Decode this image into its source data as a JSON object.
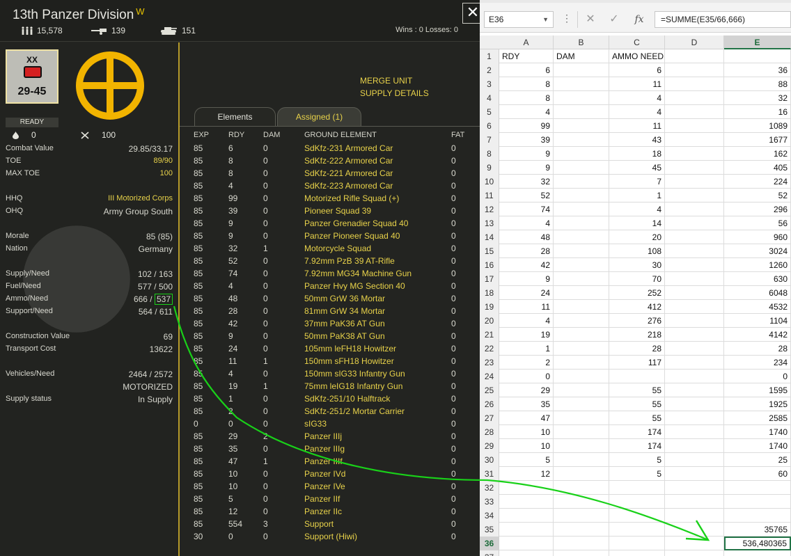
{
  "unit": {
    "title": "13th Panzer Division",
    "title_suffix": "W",
    "men": "15,578",
    "guns": "139",
    "tanks": "151",
    "wins_losses": "Wins : 0  Losses: 0",
    "counter_size": "XX",
    "counter_strength": "29-45",
    "status": "READY",
    "mini_left": "0",
    "mini_right": "100"
  },
  "stats": [
    {
      "label": "Combat Value",
      "value": "29.85/33.17",
      "style": "wh"
    },
    {
      "label": "TOE",
      "value": "89/90",
      "style": "yel"
    },
    {
      "label": "MAX TOE",
      "value": "100",
      "style": "yel"
    },
    {
      "label": "HHQ",
      "value": "III Motorized Corps",
      "style": "yel"
    },
    {
      "label": "OHQ",
      "value": "Army Group South",
      "style": "wh"
    },
    {
      "label": "Morale",
      "value": "85 (85)",
      "style": "wh"
    },
    {
      "label": "Nation",
      "value": "Germany",
      "style": "wh"
    },
    {
      "label": "Supply/Need",
      "value": "102 / 163",
      "style": "wh"
    },
    {
      "label": "Fuel/Need",
      "value": "577 / 500",
      "style": "wh"
    },
    {
      "label": "Ammo/Need",
      "value": "666 / ",
      "style": "wh",
      "highlight": "537"
    },
    {
      "label": "Support/Need",
      "value": "564 / 611",
      "style": "wh"
    },
    {
      "label": "Construction Value",
      "value": "69",
      "style": "wh"
    },
    {
      "label": "Transport Cost",
      "value": "13622",
      "style": "wh"
    },
    {
      "label": "Vehicles/Need",
      "value": "2464 / 2572",
      "style": "wh"
    },
    {
      "label": "",
      "value": "MOTORIZED",
      "style": "wh"
    },
    {
      "label": "Supply status",
      "value": "In Supply",
      "style": "wh"
    }
  ],
  "links": {
    "merge": "MERGE UNIT",
    "supply": "SUPPLY DETAILS"
  },
  "tabs": {
    "elements": "Elements",
    "assigned": "Assigned (1)"
  },
  "element_headers": {
    "exp": "EXP",
    "rdy": "RDY",
    "dam": "DAM",
    "name": "GROUND ELEMENT",
    "fat": "FAT"
  },
  "elements": [
    {
      "exp": "85",
      "rdy": "6",
      "dam": "0",
      "name": "SdKfz-231 Armored Car",
      "fat": "0"
    },
    {
      "exp": "85",
      "rdy": "8",
      "dam": "0",
      "name": "SdKfz-222 Armored Car",
      "fat": "0"
    },
    {
      "exp": "85",
      "rdy": "8",
      "dam": "0",
      "name": "SdKfz-221 Armored Car",
      "fat": "0"
    },
    {
      "exp": "85",
      "rdy": "4",
      "dam": "0",
      "name": "SdKfz-223 Armored Car",
      "fat": "0"
    },
    {
      "exp": "85",
      "rdy": "99",
      "dam": "0",
      "name": "Motorized Rifle Squad (+)",
      "fat": "0"
    },
    {
      "exp": "85",
      "rdy": "39",
      "dam": "0",
      "name": "Pioneer Squad 39",
      "fat": "0"
    },
    {
      "exp": "85",
      "rdy": "9",
      "dam": "0",
      "name": "Panzer Grenadier Squad 40",
      "fat": "0"
    },
    {
      "exp": "85",
      "rdy": "9",
      "dam": "0",
      "name": "Panzer Pioneer Squad 40",
      "fat": "0"
    },
    {
      "exp": "85",
      "rdy": "32",
      "dam": "1",
      "name": "Motorcycle Squad",
      "fat": "0"
    },
    {
      "exp": "85",
      "rdy": "52",
      "dam": "0",
      "name": "7.92mm PzB 39 AT-Rifle",
      "fat": "0"
    },
    {
      "exp": "85",
      "rdy": "74",
      "dam": "0",
      "name": "7.92mm MG34 Machine Gun",
      "fat": "0"
    },
    {
      "exp": "85",
      "rdy": "4",
      "dam": "0",
      "name": "Panzer Hvy MG Section 40",
      "fat": "0"
    },
    {
      "exp": "85",
      "rdy": "48",
      "dam": "0",
      "name": "50mm GrW 36 Mortar",
      "fat": "0"
    },
    {
      "exp": "85",
      "rdy": "28",
      "dam": "0",
      "name": "81mm GrW 34 Mortar",
      "fat": "0"
    },
    {
      "exp": "85",
      "rdy": "42",
      "dam": "0",
      "name": "37mm PaK36 AT Gun",
      "fat": "0"
    },
    {
      "exp": "85",
      "rdy": "9",
      "dam": "0",
      "name": "50mm PaK38 AT Gun",
      "fat": "0"
    },
    {
      "exp": "85",
      "rdy": "24",
      "dam": "0",
      "name": "105mm leFH18 Howitzer",
      "fat": "0"
    },
    {
      "exp": "85",
      "rdy": "11",
      "dam": "1",
      "name": "150mm sFH18 Howitzer",
      "fat": "0"
    },
    {
      "exp": "85",
      "rdy": "4",
      "dam": "0",
      "name": "150mm sIG33 Infantry Gun",
      "fat": "0"
    },
    {
      "exp": "85",
      "rdy": "19",
      "dam": "1",
      "name": "75mm leIG18 Infantry Gun",
      "fat": "0"
    },
    {
      "exp": "85",
      "rdy": "1",
      "dam": "0",
      "name": "SdKfz-251/10 Halftrack",
      "fat": "0"
    },
    {
      "exp": "85",
      "rdy": "2",
      "dam": "0",
      "name": "SdKfz-251/2 Mortar Carrier",
      "fat": "0"
    },
    {
      "exp": "0",
      "rdy": "0",
      "dam": "0",
      "name": "sIG33",
      "fat": "0"
    },
    {
      "exp": "85",
      "rdy": "29",
      "dam": "2",
      "name": "Panzer IIIj",
      "fat": "0"
    },
    {
      "exp": "85",
      "rdy": "35",
      "dam": "0",
      "name": "Panzer IIIg",
      "fat": "0"
    },
    {
      "exp": "85",
      "rdy": "47",
      "dam": "1",
      "name": "Panzer IIIf",
      "fat": "0"
    },
    {
      "exp": "85",
      "rdy": "10",
      "dam": "0",
      "name": "Panzer IVd",
      "fat": "0"
    },
    {
      "exp": "85",
      "rdy": "10",
      "dam": "0",
      "name": "Panzer IVe",
      "fat": "0"
    },
    {
      "exp": "85",
      "rdy": "5",
      "dam": "0",
      "name": "Panzer IIf",
      "fat": "0"
    },
    {
      "exp": "85",
      "rdy": "12",
      "dam": "0",
      "name": "Panzer IIc",
      "fat": "0"
    },
    {
      "exp": "85",
      "rdy": "554",
      "dam": "3",
      "name": "Support",
      "fat": "0"
    },
    {
      "exp": "30",
      "rdy": "0",
      "dam": "0",
      "name": "Support (Hiwi)",
      "fat": "0"
    }
  ],
  "sheet": {
    "name_box": "E36",
    "formula": "=SUMME(E35/66,666)",
    "fx_label": "fx",
    "columns": [
      "A",
      "B",
      "C",
      "D",
      "E"
    ],
    "active_column": "E",
    "active_row": "36",
    "rows": [
      {
        "n": "1",
        "A": "RDY",
        "B": "DAM",
        "C": "AMMO NEED",
        "D": "",
        "E": ""
      },
      {
        "n": "2",
        "A": "6",
        "B": "",
        "C": "6",
        "D": "",
        "E": "36"
      },
      {
        "n": "3",
        "A": "8",
        "B": "",
        "C": "11",
        "D": "",
        "E": "88"
      },
      {
        "n": "4",
        "A": "8",
        "B": "",
        "C": "4",
        "D": "",
        "E": "32"
      },
      {
        "n": "5",
        "A": "4",
        "B": "",
        "C": "4",
        "D": "",
        "E": "16"
      },
      {
        "n": "6",
        "A": "99",
        "B": "",
        "C": "11",
        "D": "",
        "E": "1089"
      },
      {
        "n": "7",
        "A": "39",
        "B": "",
        "C": "43",
        "D": "",
        "E": "1677"
      },
      {
        "n": "8",
        "A": "9",
        "B": "",
        "C": "18",
        "D": "",
        "E": "162"
      },
      {
        "n": "9",
        "A": "9",
        "B": "",
        "C": "45",
        "D": "",
        "E": "405"
      },
      {
        "n": "10",
        "A": "32",
        "B": "",
        "C": "7",
        "D": "",
        "E": "224"
      },
      {
        "n": "11",
        "A": "52",
        "B": "",
        "C": "1",
        "D": "",
        "E": "52"
      },
      {
        "n": "12",
        "A": "74",
        "B": "",
        "C": "4",
        "D": "",
        "E": "296"
      },
      {
        "n": "13",
        "A": "4",
        "B": "",
        "C": "14",
        "D": "",
        "E": "56"
      },
      {
        "n": "14",
        "A": "48",
        "B": "",
        "C": "20",
        "D": "",
        "E": "960"
      },
      {
        "n": "15",
        "A": "28",
        "B": "",
        "C": "108",
        "D": "",
        "E": "3024"
      },
      {
        "n": "16",
        "A": "42",
        "B": "",
        "C": "30",
        "D": "",
        "E": "1260"
      },
      {
        "n": "17",
        "A": "9",
        "B": "",
        "C": "70",
        "D": "",
        "E": "630"
      },
      {
        "n": "18",
        "A": "24",
        "B": "",
        "C": "252",
        "D": "",
        "E": "6048"
      },
      {
        "n": "19",
        "A": "11",
        "B": "",
        "C": "412",
        "D": "",
        "E": "4532"
      },
      {
        "n": "20",
        "A": "4",
        "B": "",
        "C": "276",
        "D": "",
        "E": "1104"
      },
      {
        "n": "21",
        "A": "19",
        "B": "",
        "C": "218",
        "D": "",
        "E": "4142"
      },
      {
        "n": "22",
        "A": "1",
        "B": "",
        "C": "28",
        "D": "",
        "E": "28"
      },
      {
        "n": "23",
        "A": "2",
        "B": "",
        "C": "117",
        "D": "",
        "E": "234"
      },
      {
        "n": "24",
        "A": "0",
        "B": "",
        "C": "",
        "D": "",
        "E": "0"
      },
      {
        "n": "25",
        "A": "29",
        "B": "",
        "C": "55",
        "D": "",
        "E": "1595"
      },
      {
        "n": "26",
        "A": "35",
        "B": "",
        "C": "55",
        "D": "",
        "E": "1925"
      },
      {
        "n": "27",
        "A": "47",
        "B": "",
        "C": "55",
        "D": "",
        "E": "2585"
      },
      {
        "n": "28",
        "A": "10",
        "B": "",
        "C": "174",
        "D": "",
        "E": "1740"
      },
      {
        "n": "29",
        "A": "10",
        "B": "",
        "C": "174",
        "D": "",
        "E": "1740"
      },
      {
        "n": "30",
        "A": "5",
        "B": "",
        "C": "5",
        "D": "",
        "E": "25"
      },
      {
        "n": "31",
        "A": "12",
        "B": "",
        "C": "5",
        "D": "",
        "E": "60"
      },
      {
        "n": "32",
        "A": "",
        "B": "",
        "C": "",
        "D": "",
        "E": ""
      },
      {
        "n": "33",
        "A": "",
        "B": "",
        "C": "",
        "D": "",
        "E": ""
      },
      {
        "n": "34",
        "A": "",
        "B": "",
        "C": "",
        "D": "",
        "E": ""
      },
      {
        "n": "35",
        "A": "",
        "B": "",
        "C": "",
        "D": "",
        "E": "35765"
      },
      {
        "n": "36",
        "A": "",
        "B": "",
        "C": "",
        "D": "",
        "E": "536,480365"
      },
      {
        "n": "37",
        "A": "",
        "B": "",
        "C": "",
        "D": "",
        "E": ""
      }
    ]
  },
  "colors": {
    "accent_yellow": "#e8d24a",
    "annotation_green": "#19d119",
    "excel_green": "#217346",
    "emblem": "#f2b400"
  }
}
